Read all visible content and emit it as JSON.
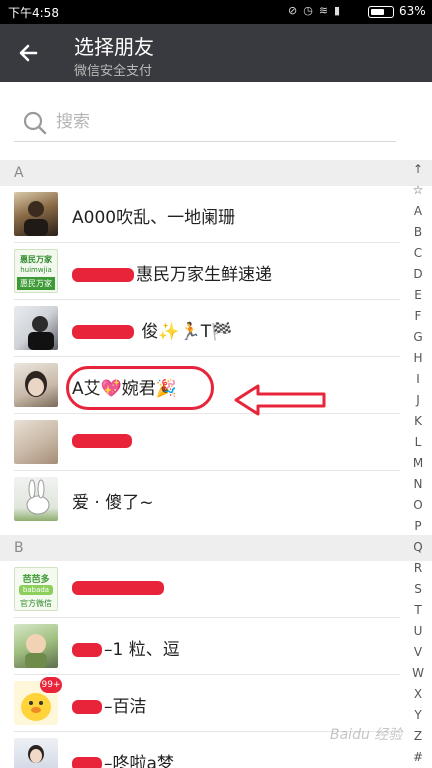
{
  "status_bar": {
    "time": "下午4:58",
    "battery": "63%",
    "battery_level": 0.63,
    "icons": [
      "mute-icon",
      "alarm-icon",
      "wifi-icon",
      "signal-icon"
    ]
  },
  "header": {
    "title": "选择朋友",
    "subtitle": "微信安全支付"
  },
  "search": {
    "placeholder": "搜索"
  },
  "sections": [
    {
      "letter": "A",
      "contacts": [
        {
          "name": "A000吹乱、一地阑珊"
        },
        {
          "name": "惠民万家生鲜速递",
          "avatar_text": [
            "惠民万家",
            "huimwjia",
            "惠民万家"
          ]
        },
        {
          "name": "俊✨🏃T🏁"
        },
        {
          "name": "A艾💖婉君🎉"
        },
        {
          "name": ""
        },
        {
          "name": "爱 · 傻了~"
        }
      ]
    },
    {
      "letter": "B",
      "contacts": [
        {
          "name": "",
          "avatar_text": [
            "芭芭多",
            "babada",
            "官方微信"
          ]
        },
        {
          "name": "–1 粒、逗"
        },
        {
          "name": "–百洁",
          "badge": "99+"
        },
        {
          "name": "–咚啦a梦"
        }
      ]
    }
  ],
  "index_letters": [
    "↑",
    "☆",
    "A",
    "B",
    "C",
    "D",
    "E",
    "F",
    "G",
    "H",
    "I",
    "J",
    "K",
    "L",
    "M",
    "N",
    "O",
    "P",
    "Q",
    "R",
    "S",
    "T",
    "U",
    "V",
    "W",
    "X",
    "Y",
    "Z",
    "#"
  ],
  "watermark": "Baidu 经验",
  "colors": {
    "header": "#393a3f",
    "annotation": "#e8243a",
    "section_bg": "#eeeeee"
  }
}
